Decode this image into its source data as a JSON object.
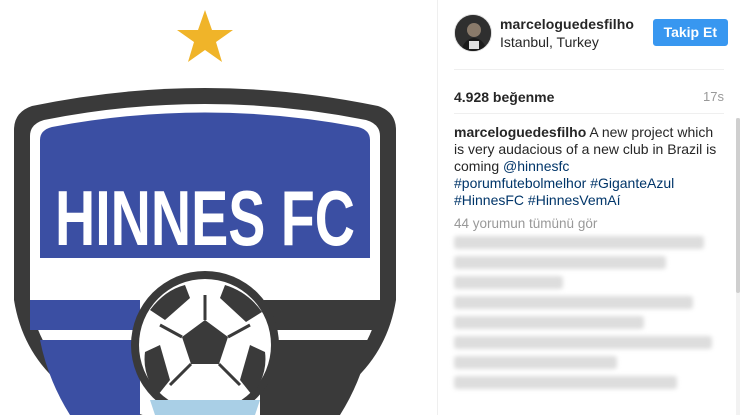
{
  "post": {
    "username": "marceloguedesfilho",
    "location": "Istanbul, Turkey",
    "follow_label": "Takip Et",
    "likes": "4.928 beğenme",
    "time_ago": "17s",
    "caption_text": "A new project which is very audacious of a new club in Brazil is coming",
    "mention": "@hinnesfc",
    "hashtags": [
      "#porumfutebolmelhor",
      "#GiganteAzul",
      "#HinnesFC",
      "#HinnesVemAí"
    ],
    "view_comments": "44 yorumun tümünü gör"
  },
  "image": {
    "crest_text": "HINNES FC",
    "colors": {
      "blue": "#3b4fa3",
      "dark": "#3a3a3a",
      "gold": "#f0b429",
      "light_blue": "#a9cfe6"
    }
  },
  "colors": {
    "accent": "#3897f0",
    "link": "#003569",
    "muted": "#999999",
    "text": "#262626"
  }
}
